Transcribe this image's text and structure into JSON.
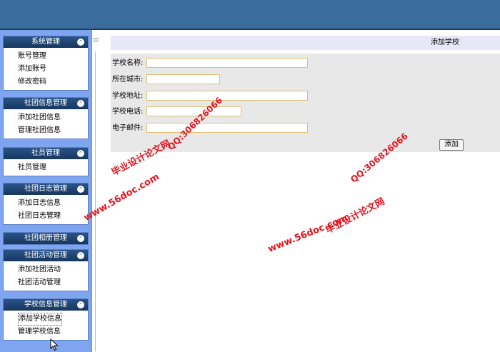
{
  "sidebar": {
    "panels": [
      {
        "title": "系统管理",
        "items": [
          "账号管理",
          "添加账号",
          "修改密码"
        ]
      },
      {
        "title": "社团信息管理",
        "items": [
          "添加社团信息",
          "管理社团信息"
        ]
      },
      {
        "title": "社员管理",
        "items": [
          "社员管理"
        ]
      },
      {
        "title": "社团日志管理",
        "items": [
          "添加日志信息",
          "社团日志管理"
        ]
      },
      {
        "title": "社团相册管理",
        "items": []
      },
      {
        "title": "社团活动管理",
        "items": [
          "添加社团活动",
          "社团活动管理"
        ]
      },
      {
        "title": "学校信息管理",
        "items": [
          "添加学校信息",
          "管理学校信息"
        ]
      }
    ],
    "toggle_glyph": "⌃"
  },
  "content": {
    "title": "添加学校",
    "fields": {
      "name": {
        "label": "学校名称:",
        "value": ""
      },
      "city": {
        "label": "所在城市:",
        "value": ""
      },
      "address": {
        "label": "学校地址:",
        "value": ""
      },
      "phone": {
        "label": "学校电话:",
        "value": ""
      },
      "email": {
        "label": "电子邮件:",
        "value": ""
      }
    },
    "submit_label": "添加"
  },
  "watermark": {
    "site": "www.56doc.com",
    "qq": "QQ:306826066",
    "name": "毕业设计论文网"
  },
  "colors": {
    "topbar": "#3a6c9c",
    "sidebar_bg": "#7fa4f0",
    "panel_header": "#1e3f6d",
    "form_bg": "#e8e8e8",
    "title_bg": "#e6e8f8",
    "input_border": "#e0c070",
    "watermark": "#e8141e"
  }
}
